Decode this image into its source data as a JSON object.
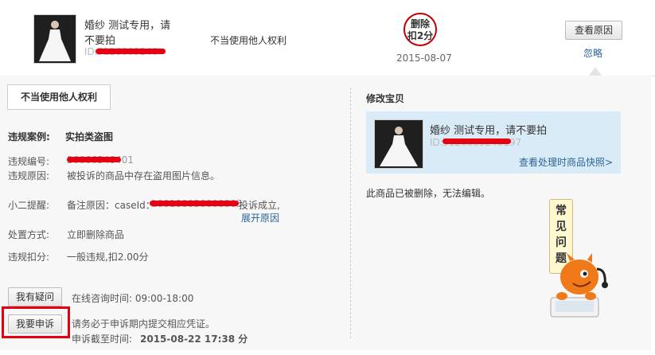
{
  "top": {
    "title_line1": "婚纱 测试专用，请",
    "title_line2": "不要拍",
    "id_prefix": "ID:",
    "id_value": "5126069240",
    "reason": "不当使用他人权利",
    "stamp_line1": "删除",
    "stamp_line2": "扣2分",
    "date": "2015-08-07",
    "view_reason_button": "查看原因",
    "ignore_link": "忽略"
  },
  "left": {
    "tab_label": "不当使用他人权利",
    "case_label": "违规案例:",
    "case_value": "实拍类盗图",
    "code_label": "违规编号:",
    "code_value": "26066548401",
    "cause_label": "违规原因:",
    "cause_value": "被投诉的商品中存在盗用图片信息。",
    "reminder_label": "小二提醒:",
    "reminder_prefix": "备注原因：caseId：",
    "reminder_case": "100180030000003",
    "reminder_suffix": "投诉成立,",
    "expand_link": "展开原因",
    "method_label": "处置方式:",
    "method_value": "立即删除商品",
    "deduct_label": "违规扣分:",
    "deduct_value": "一般违规,扣2.00分",
    "question_button": "我有疑问",
    "consult_text": "在线咨询时间: 09:00-18:00",
    "appeal_button": "我要申诉",
    "appeal_note": "请务必于申诉期内提交相应凭证。",
    "deadline_label": "申诉截至时间:",
    "deadline_value": "2015-08-22 17:38 分"
  },
  "right": {
    "heading": "修改宝贝",
    "item_title": "婚纱 测试专用，请不要拍",
    "item_id_prefix": "ID:",
    "item_id_value": "5126069240197",
    "snapshot_link": "查看处理时商品快照>",
    "deleted_note": "此商品已被删除，无法编辑。",
    "faq_text": "常见问题"
  },
  "colors": {
    "accent_red": "#e60012",
    "link_blue": "#2a6496",
    "info_bg": "#d9ebf6"
  }
}
